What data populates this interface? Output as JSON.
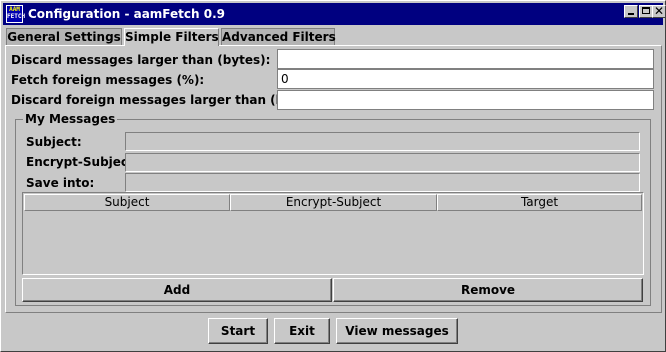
{
  "window": {
    "title": "Configuration - aamFetch 0.9",
    "icon_line1": "AAM",
    "icon_line2": "FETCH"
  },
  "tabs": [
    {
      "label": "General Settings",
      "selected": false
    },
    {
      "label": "Simple Filters",
      "selected": true
    },
    {
      "label": "Advanced Filters",
      "selected": false
    }
  ],
  "simple_filters": {
    "discard_label": "Discard messages larger than (bytes):",
    "discard_value": "",
    "fetch_foreign_label": "Fetch foreign messages (%):",
    "fetch_foreign_value": "0",
    "discard_foreign_label": "Discard foreign messages larger than (bytes):",
    "discard_foreign_value": ""
  },
  "my_messages": {
    "title": "My Messages",
    "subject_label": "Subject:",
    "encrypt_subject_label": "Encrypt-Subject:",
    "save_into_label": "Save into:",
    "table_columns": [
      "Subject",
      "Encrypt-Subject",
      "Target"
    ],
    "add_label": "Add",
    "remove_label": "Remove"
  },
  "footer": {
    "start_label": "Start",
    "exit_label": "Exit",
    "view_label": "View messages"
  }
}
